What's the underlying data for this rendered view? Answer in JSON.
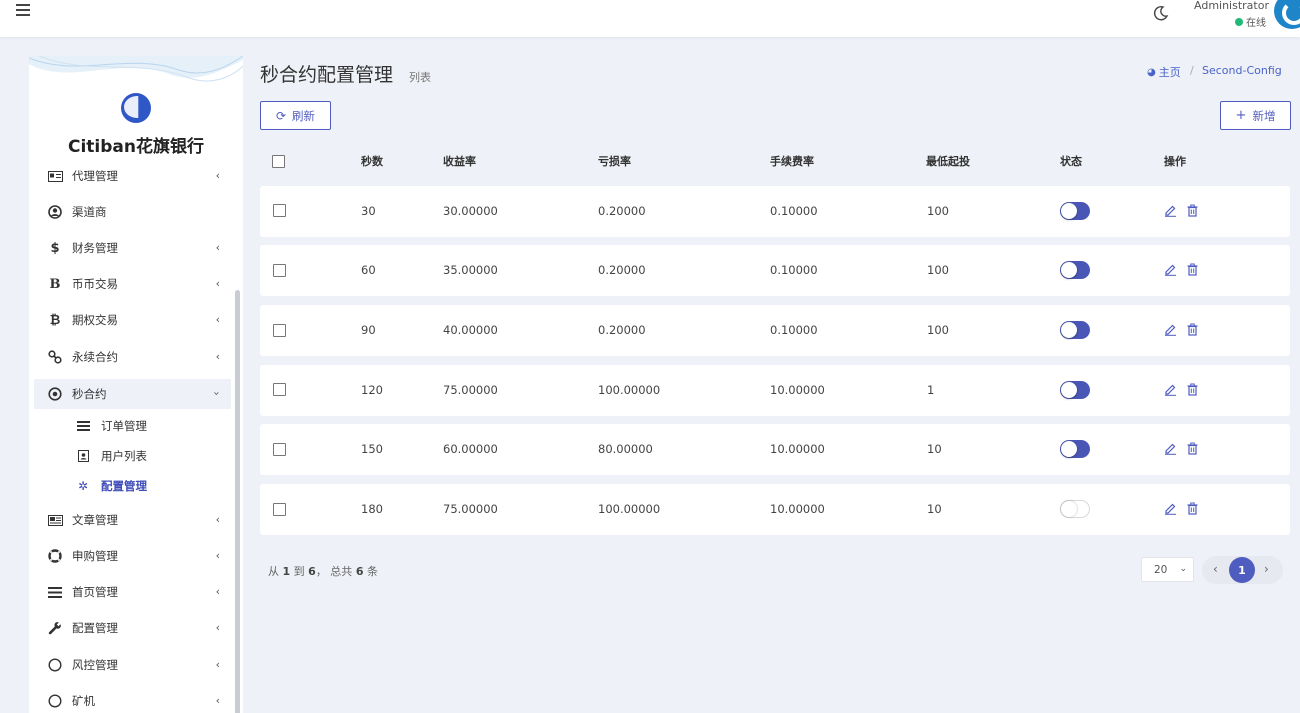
{
  "header": {
    "user_name": "Administrator",
    "user_status": "在线"
  },
  "sidebar": {
    "brand": "Citiban花旗银行",
    "items": [
      {
        "label": "代理管理",
        "icon": "id-card-icon"
      },
      {
        "label": "渠道商",
        "icon": "user-circle-icon"
      },
      {
        "label": "财务管理",
        "icon": "dollar-icon"
      },
      {
        "label": "币币交易",
        "icon": "letter-b-icon"
      },
      {
        "label": "期权交易",
        "icon": "bitcoin-icon"
      },
      {
        "label": "永续合约",
        "icon": "link-icon"
      },
      {
        "label": "秒合约",
        "icon": "dot-circle-icon"
      },
      {
        "label": "文章管理",
        "icon": "newspaper-icon"
      },
      {
        "label": "申购管理",
        "icon": "life-ring-icon"
      },
      {
        "label": "首页管理",
        "icon": "list-icon"
      },
      {
        "label": "配置管理",
        "icon": "wrench-icon"
      },
      {
        "label": "风控管理",
        "icon": "circle-icon"
      },
      {
        "label": "矿机",
        "icon": "circle-icon"
      }
    ],
    "sub_items": [
      {
        "label": "订单管理",
        "icon": "list-icon"
      },
      {
        "label": "用户列表",
        "icon": "user-card-icon"
      },
      {
        "label": "配置管理",
        "icon": "gear-icon"
      }
    ]
  },
  "page": {
    "title": "秒合约配置管理",
    "subtitle": "列表",
    "breadcrumb_home": "主页",
    "breadcrumb_separator": "/",
    "breadcrumb_current": "Second-Config",
    "refresh_label": "刷新",
    "add_label": "新增"
  },
  "table": {
    "columns": [
      "秒数",
      "收益率",
      "亏损率",
      "手续费率",
      "最低起投",
      "状态",
      "操作"
    ],
    "rows": [
      {
        "seconds": "30",
        "profit": "30.00000",
        "loss": "0.20000",
        "fee": "0.10000",
        "min": "100",
        "enabled": true
      },
      {
        "seconds": "60",
        "profit": "35.00000",
        "loss": "0.20000",
        "fee": "0.10000",
        "min": "100",
        "enabled": true
      },
      {
        "seconds": "90",
        "profit": "40.00000",
        "loss": "0.20000",
        "fee": "0.10000",
        "min": "100",
        "enabled": true
      },
      {
        "seconds": "120",
        "profit": "75.00000",
        "loss": "100.00000",
        "fee": "10.00000",
        "min": "1",
        "enabled": true
      },
      {
        "seconds": "150",
        "profit": "60.00000",
        "loss": "80.00000",
        "fee": "10.00000",
        "min": "10",
        "enabled": true
      },
      {
        "seconds": "180",
        "profit": "75.00000",
        "loss": "100.00000",
        "fee": "10.00000",
        "min": "10",
        "enabled": false
      }
    ]
  },
  "footer": {
    "summary_prefix": "从",
    "from": "1",
    "summary_mid": "到",
    "to": "6",
    "summary_total_prefix": "， 总共",
    "total": "6",
    "summary_suffix": "条",
    "page_size": "20",
    "current_page": "1"
  },
  "colors": {
    "accent": "#4f5cc0",
    "background": "#eef1f7",
    "online": "#21b978"
  }
}
